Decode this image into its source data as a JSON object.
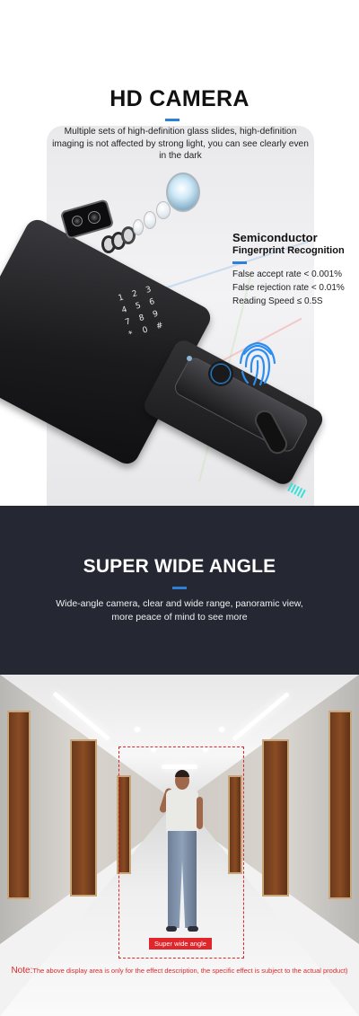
{
  "hd_camera": {
    "title": "HD CAMERA",
    "description": "Multiple sets of high-definition glass slides, high-definition imaging is not affected by strong light, you can see clearly even in the dark"
  },
  "fingerprint": {
    "title": "Semiconductor",
    "subtitle": "Fingerprint Recognition",
    "specs": [
      "False accept rate < 0.001%",
      "False rejection rate < 0.01%",
      "Reading Speed ≤ 0.5S"
    ]
  },
  "keypad": {
    "keys": [
      "1",
      "2",
      "3",
      "4",
      "5",
      "6",
      "7",
      "8",
      "9",
      "*",
      "0",
      "#"
    ]
  },
  "wide_angle": {
    "title": "SUPER WIDE ANGLE",
    "description": "Wide-angle camera, clear and wide range, panoramic view, more peace of mind to see more"
  },
  "corridor": {
    "frame_label": "Super wide angle",
    "note_prefix": "Note:",
    "note_text": "The above display area is only for the effect description, the specific effect is subject to the actual product)"
  },
  "colors": {
    "accent_blue": "#2f7fd8",
    "dark_band": "#252833",
    "alert_red": "#e0262b"
  }
}
